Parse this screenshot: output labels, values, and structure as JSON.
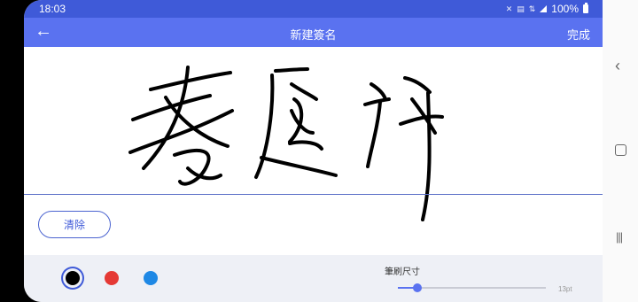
{
  "status_bar": {
    "time": "18:03",
    "indicators": [
      "mute-icon",
      "volte-icon",
      "4g-icon",
      "signal-icon"
    ],
    "battery": "100%"
  },
  "app_bar": {
    "back_icon": "arrow-back-icon",
    "title": "新建簽名",
    "done_label": "完成"
  },
  "signature": {
    "stroke_color": "#000000"
  },
  "clear_button": {
    "label": "清除"
  },
  "toolbar": {
    "colors": [
      {
        "name": "black",
        "hex": "#000000",
        "selected": true
      },
      {
        "name": "red",
        "hex": "#e53935",
        "selected": false
      },
      {
        "name": "blue",
        "hex": "#1e88e5",
        "selected": false
      }
    ],
    "brush_size_label": "筆刷尺寸",
    "brush_size_value": "13pt",
    "brush_size_fraction": 0.13
  },
  "nav_bar": {
    "back_icon": "chevron-left-icon",
    "home_icon": "home-icon",
    "recents_icon": "recents-icon"
  },
  "colors": {
    "primary": "#5a72f0",
    "primary_dark": "#3f5ad8",
    "toolbar_bg": "#eef0f6"
  }
}
